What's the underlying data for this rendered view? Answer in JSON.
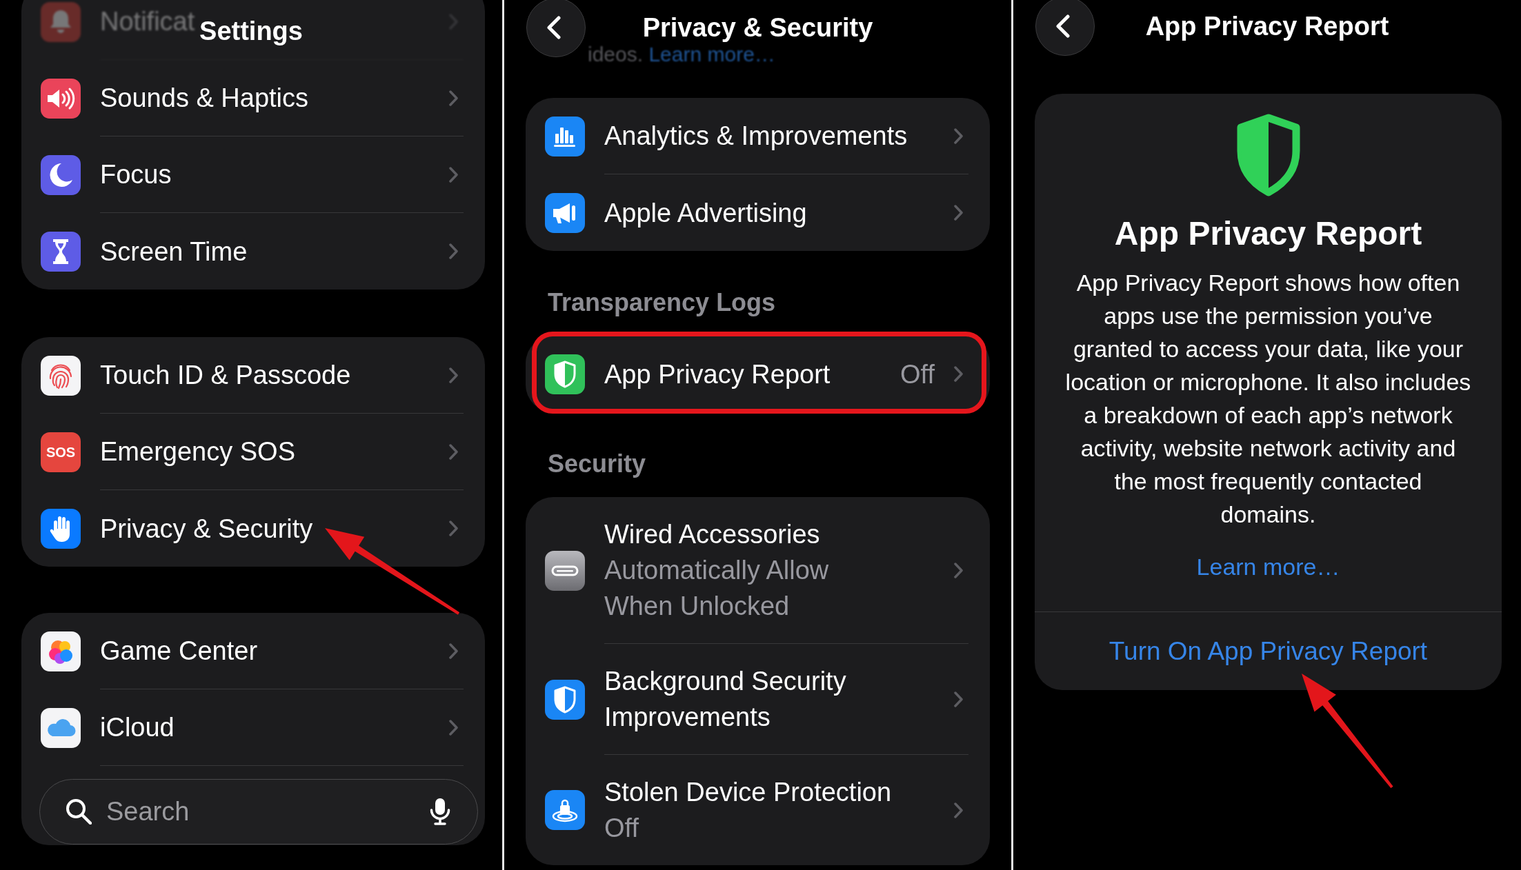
{
  "settings_screen": {
    "title": "Settings",
    "faded_row": {
      "label": "Notificat"
    },
    "groups": [
      {
        "rows": [
          {
            "label": "Sounds & Haptics",
            "arrow": false
          },
          {
            "label": "Focus",
            "arrow": false
          },
          {
            "label": "Screen Time",
            "arrow": false
          }
        ]
      },
      {
        "rows": [
          {
            "label": "Touch ID & Passcode",
            "arrow": false
          },
          {
            "label": "Emergency SOS",
            "icon_text": "SOS",
            "arrow": false
          },
          {
            "label": "Privacy & Security",
            "arrow": true
          }
        ]
      },
      {
        "rows": [
          {
            "label": "Game Center",
            "arrow": false
          },
          {
            "label": "iCloud",
            "arrow": false
          }
        ]
      }
    ],
    "search": {
      "placeholder": "Search"
    }
  },
  "privacy_screen": {
    "title": "Privacy & Security",
    "faded_note": {
      "text": "ideos.",
      "link": "Learn more…"
    },
    "sections": [
      {
        "rows": [
          {
            "label": "Analytics & Improvements",
            "highlighted": false
          },
          {
            "label": "Apple Advertising",
            "highlighted": false
          }
        ]
      },
      {
        "header": "Transparency Logs",
        "rows": [
          {
            "label": "App Privacy Report",
            "value": "Off",
            "highlighted": true
          }
        ]
      },
      {
        "header": "Security",
        "rows": [
          {
            "label": "Wired Accessories",
            "detail": "Automatically Allow When Unlocked",
            "highlighted": false
          },
          {
            "label": "Background Security Improvements",
            "highlighted": false
          },
          {
            "label": "Stolen Device Protection",
            "detail": "Off",
            "highlighted": false
          }
        ]
      }
    ]
  },
  "report_screen": {
    "title": "App Privacy Report",
    "card": {
      "heading": "App Privacy Report",
      "body": "App Privacy Report shows how often apps use the permission you’ve granted to access your data, like your location or microphone. It also includes a breakdown of each app’s network activity, website network activity and the most frequently contacted domains.",
      "link": "Learn more…",
      "action": "Turn On App Privacy Report",
      "arrow": true
    }
  }
}
